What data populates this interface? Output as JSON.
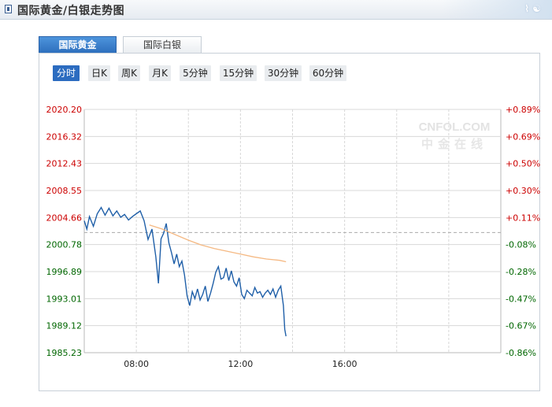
{
  "header": {
    "title": "国际黄金/白银走势图"
  },
  "tabs": [
    {
      "label": "国际黄金",
      "active": true
    },
    {
      "label": "国际白银",
      "active": false
    }
  ],
  "periods": [
    {
      "label": "分时",
      "active": true
    },
    {
      "label": "日K",
      "active": false
    },
    {
      "label": "周K",
      "active": false
    },
    {
      "label": "月K",
      "active": false
    },
    {
      "label": "5分钟",
      "active": false
    },
    {
      "label": "15分钟",
      "active": false
    },
    {
      "label": "30分钟",
      "active": false
    },
    {
      "label": "60分钟",
      "active": false
    }
  ],
  "watermark": {
    "en": "CNFOL.COM",
    "cn": "中金在线"
  },
  "colors": {
    "up": "#cc0000",
    "down": "#006600",
    "price_line": "#1f5fa8",
    "avg_line": "#f5b983",
    "grid": "#d8d8d8",
    "baseline": "#aaaaaa"
  },
  "chart_data": {
    "type": "line",
    "y_ticks_left": [
      "2020.20",
      "2016.32",
      "2012.43",
      "2008.55",
      "2004.66",
      "2000.78",
      "1996.89",
      "1993.01",
      "1989.12",
      "1985.23"
    ],
    "y_ticks_right": [
      "+0.89%",
      "+0.69%",
      "+0.50%",
      "+0.30%",
      "+0.11%",
      "-0.08%",
      "-0.28%",
      "-0.47%",
      "-0.67%",
      "-0.86%"
    ],
    "ylim": [
      1985.23,
      2020.2
    ],
    "baseline_price": 2002.5,
    "x_labels": [
      "08:00",
      "12:00",
      "16:00"
    ],
    "xlim_hours": [
      6.0,
      22.0
    ],
    "series": [
      {
        "role": "price",
        "x_hours": [
          6.0,
          6.1,
          6.2,
          6.35,
          6.5,
          6.65,
          6.8,
          6.95,
          7.1,
          7.25,
          7.4,
          7.55,
          7.7,
          7.85,
          8.0,
          8.15,
          8.3,
          8.45,
          8.6,
          8.75,
          8.85,
          8.95,
          9.05,
          9.15,
          9.25,
          9.35,
          9.45,
          9.55,
          9.65,
          9.75,
          9.85,
          9.95,
          10.05,
          10.15,
          10.25,
          10.35,
          10.45,
          10.55,
          10.65,
          10.75,
          10.85,
          10.95,
          11.05,
          11.15,
          11.25,
          11.35,
          11.45,
          11.55,
          11.65,
          11.75,
          11.85,
          11.95,
          12.05,
          12.15,
          12.25,
          12.35,
          12.45,
          12.55,
          12.65,
          12.75,
          12.85,
          12.95,
          13.05,
          13.15,
          13.25,
          13.35,
          13.45,
          13.55,
          13.65,
          13.7,
          13.75
        ],
        "y": [
          2004.2,
          2003.0,
          2004.8,
          2003.4,
          2005.2,
          2006.1,
          2005.0,
          2006.0,
          2004.9,
          2005.6,
          2004.7,
          2005.1,
          2004.3,
          2004.8,
          2005.2,
          2005.6,
          2004.2,
          2001.5,
          2003.0,
          1999.0,
          1995.2,
          2001.6,
          2002.4,
          2003.8,
          2001.0,
          1999.6,
          1998.0,
          1999.4,
          1997.6,
          1998.4,
          1996.4,
          1993.4,
          1992.0,
          1994.0,
          1993.0,
          1994.4,
          1992.8,
          1993.6,
          1994.8,
          1992.6,
          1993.8,
          1995.2,
          1996.8,
          1997.6,
          1995.8,
          1996.0,
          1997.4,
          1995.6,
          1997.0,
          1995.4,
          1994.8,
          1996.0,
          1993.6,
          1993.0,
          1994.2,
          1993.8,
          1993.4,
          1994.6,
          1993.8,
          1994.0,
          1993.2,
          1993.8,
          1994.2,
          1993.6,
          1994.4,
          1993.2,
          1994.2,
          1994.8,
          1992.0,
          1988.6,
          1987.6
        ]
      },
      {
        "role": "average",
        "x_hours": [
          8.5,
          9.0,
          9.5,
          10.0,
          10.5,
          11.0,
          11.5,
          12.0,
          12.5,
          13.0,
          13.5,
          13.75
        ],
        "y": [
          2003.6,
          2003.0,
          2002.2,
          2001.4,
          2000.7,
          2000.2,
          1999.8,
          1999.4,
          1999.0,
          1998.7,
          1998.5,
          1998.3
        ]
      }
    ]
  }
}
